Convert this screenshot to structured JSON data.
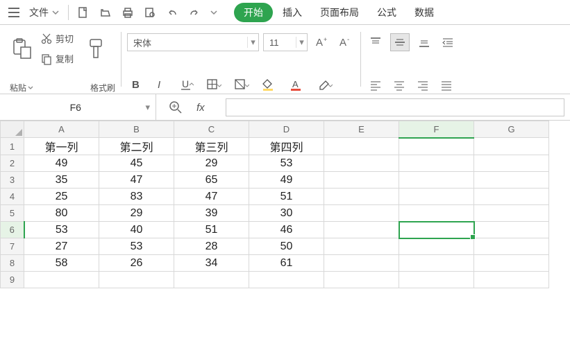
{
  "menubar": {
    "file": "文件",
    "tabs": {
      "start": "开始",
      "insert": "插入",
      "layout": "页面布局",
      "formula": "公式",
      "data": "数据"
    }
  },
  "ribbon": {
    "paste": "粘贴",
    "cut": "剪切",
    "copy": "复制",
    "format_painter": "格式刷",
    "font_name": "宋体",
    "font_size": "11"
  },
  "namebox": {
    "value": "F6"
  },
  "formula": {
    "value": ""
  },
  "columns": [
    "A",
    "B",
    "C",
    "D",
    "E",
    "F",
    "G"
  ],
  "rows": [
    "1",
    "2",
    "3",
    "4",
    "5",
    "6",
    "7",
    "8",
    "9"
  ],
  "selected": {
    "col": "F",
    "row": "6"
  },
  "data": {
    "1": {
      "A": "第一列",
      "B": "第二列",
      "C": "第三列",
      "D": "第四列"
    },
    "2": {
      "A": "49",
      "B": "45",
      "C": "29",
      "D": "53"
    },
    "3": {
      "A": "35",
      "B": "47",
      "C": "65",
      "D": "49"
    },
    "4": {
      "A": "25",
      "B": "83",
      "C": "47",
      "D": "51"
    },
    "5": {
      "A": "80",
      "B": "29",
      "C": "39",
      "D": "30"
    },
    "6": {
      "A": "53",
      "B": "40",
      "C": "51",
      "D": "46"
    },
    "7": {
      "A": "27",
      "B": "53",
      "C": "28",
      "D": "50"
    },
    "8": {
      "A": "58",
      "B": "26",
      "C": "34",
      "D": "61"
    }
  }
}
